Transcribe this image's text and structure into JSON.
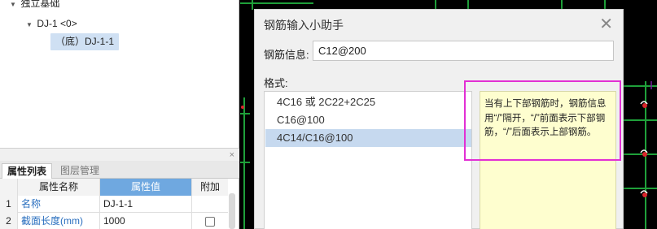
{
  "tree": {
    "root_label": "独立基础",
    "node_label": "DJ-1 <0>",
    "leaf_label": "（底）DJ-1-1"
  },
  "properties": {
    "close_glyph": "×",
    "tabs": [
      "属性列表",
      "图层管理"
    ],
    "headers": {
      "name": "属性名称",
      "value": "属性值",
      "extra": "附加"
    },
    "rows": [
      {
        "index": "1",
        "name": "名称",
        "value": "DJ-1-1",
        "has_checkbox": false
      },
      {
        "index": "2",
        "name": "截面长度(mm)",
        "value": "1000",
        "has_checkbox": true
      }
    ]
  },
  "dialog": {
    "title": "钢筋输入小助手",
    "close_glyph": "✕",
    "info_label": "钢筋信息:",
    "info_value": "C12@200",
    "format_label": "格式:",
    "format_items": [
      "4C16 或 2C22+2C25",
      "C16@100",
      "4C14/C16@100"
    ],
    "selected_index": 2,
    "help_text": "当有上下部钢筋时，钢筋信息用“/”隔开，“/”前面表示下部钢筋，“/”后面表示上部钢筋。"
  },
  "colors": {
    "accent": "#6fa8e0",
    "selection": "#c6d9ef",
    "highlight": "#e22fd4",
    "help_bg": "#fefecf",
    "cad_green": "#1fa03a",
    "cad_red": "#d8262b"
  }
}
